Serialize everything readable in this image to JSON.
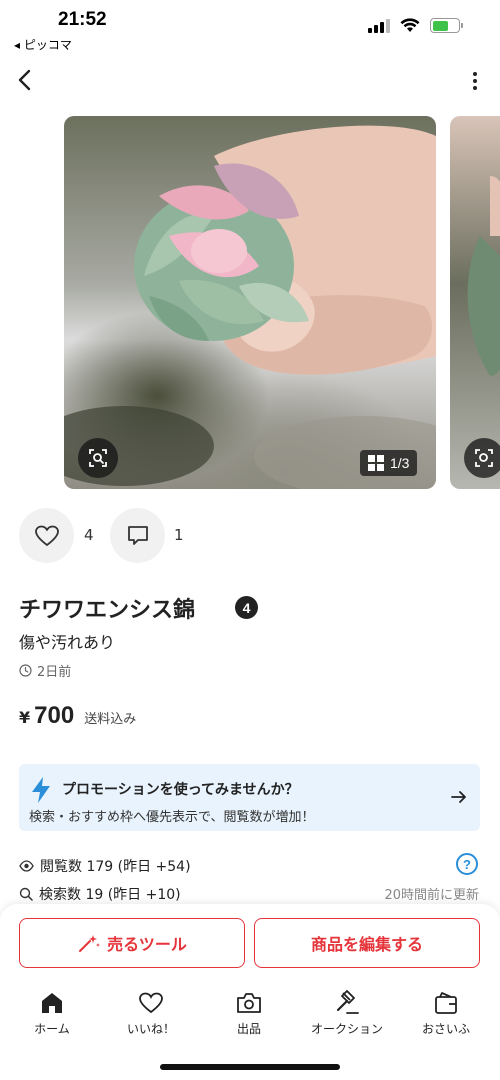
{
  "status_bar": {
    "time": "21:52",
    "back_app": "◂ ピッコマ",
    "battery_fraction": 0.6
  },
  "nav": {
    "back_icon": "chevron-left-icon",
    "more_icon": "more-vertical-icon"
  },
  "gallery": {
    "page_indicator": "1/3",
    "scan_icon": "image-search-icon",
    "grid_icon": "grid-icon"
  },
  "reactions": {
    "likes": "4",
    "comments": "1"
  },
  "item": {
    "title": "チワワエンシス錦",
    "badge": "4",
    "condition": "傷や汚れあり",
    "posted": "2日前",
    "currency": "¥",
    "price": "700",
    "shipping": "送料込み"
  },
  "promo": {
    "title": "プロモーションを使ってみませんか？",
    "description": "検索・おすすめ枠へ優先表示で、閲覧数が増加！",
    "accent": "#2a8fd8",
    "background": "#e8f3fd"
  },
  "stats": {
    "views": "閲覧数  179 (昨日 +54)",
    "searches": "検索数  19 (昨日 +10)",
    "updated": "20時間前に更新"
  },
  "actions": {
    "sell_tool": "売るツール",
    "edit_item": "商品を編集する",
    "accent": "#e5343a"
  },
  "tabs": [
    {
      "label": "ホーム",
      "icon": "home-icon"
    },
    {
      "label": "いいね！",
      "icon": "heart-icon"
    },
    {
      "label": "出品",
      "icon": "camera-icon"
    },
    {
      "label": "オークション",
      "icon": "gavel-icon"
    },
    {
      "label": "おさいふ",
      "icon": "wallet-icon"
    }
  ]
}
